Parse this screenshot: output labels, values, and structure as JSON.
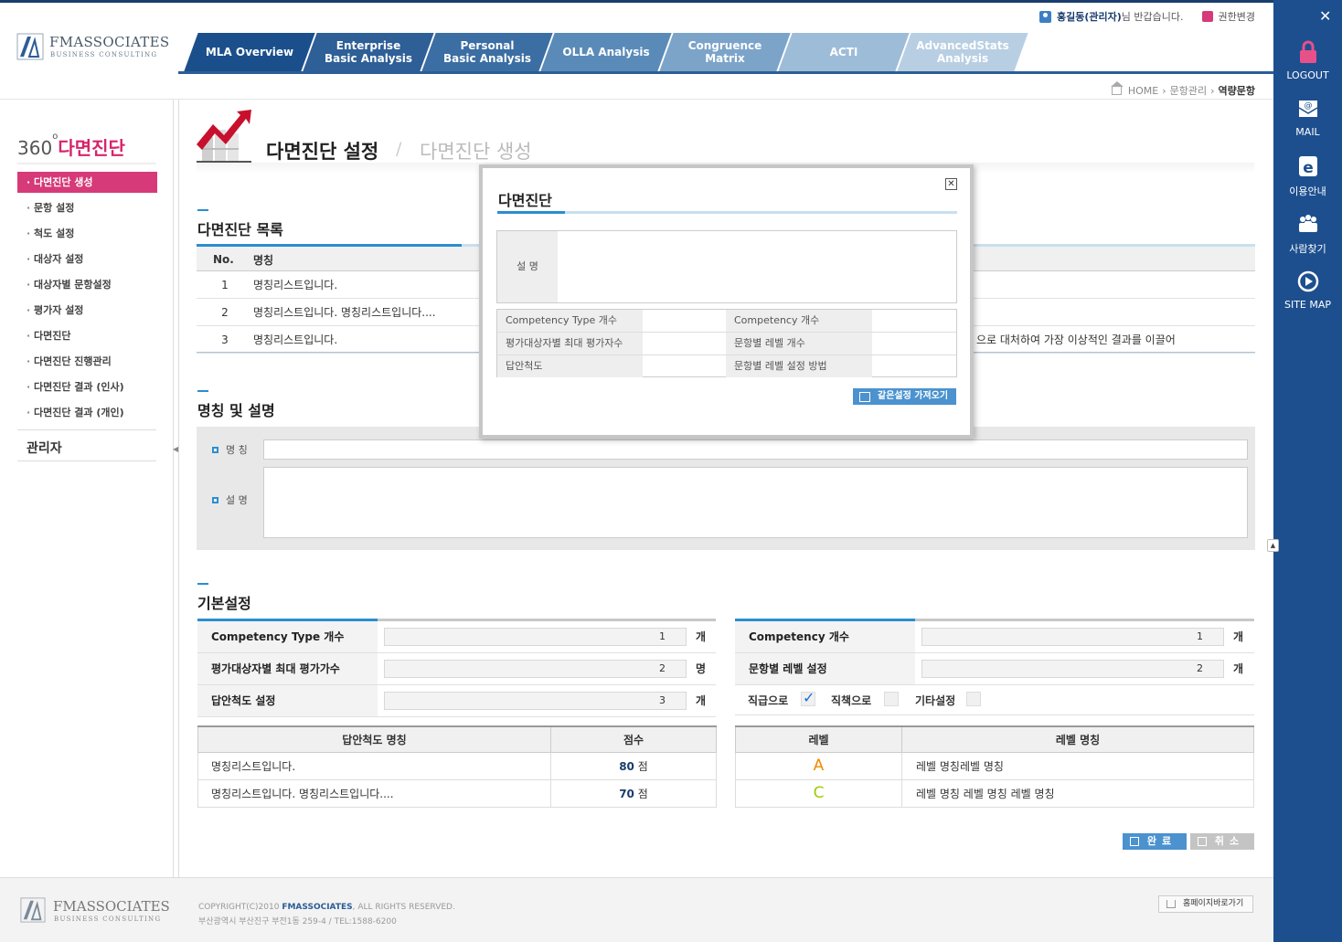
{
  "brand": {
    "name": "FMASSOCIATES",
    "tagline": "BUSINESS CONSULTING"
  },
  "user": {
    "name": "홍길동(관리자)",
    "greeting": "님 반갑습니다.",
    "role_change": "권한변경"
  },
  "nav": {
    "tabs": [
      {
        "label": "MLA Overview",
        "color": "#1a4f8c"
      },
      {
        "label": "Enterprise\nBasic Analysis",
        "color": "#2e5f96"
      },
      {
        "label": "Personal\nBasic Analysis",
        "color": "#3b6ea3"
      },
      {
        "label": "OLLA Analysis",
        "color": "#5a8bb8"
      },
      {
        "label": "Congruence\nMatrix",
        "color": "#7ca4c9"
      },
      {
        "label": "ACTI",
        "color": "#9dbcd8"
      },
      {
        "label": "AdvancedStats\nAnalysis",
        "color": "#b8cfe3"
      }
    ]
  },
  "breadcrumb": {
    "home": "HOME",
    "level1": "문항관리",
    "current": "역량문항"
  },
  "sidebar": {
    "title_num": "360",
    "title_deg": "o",
    "title_text": "다면진단",
    "items": [
      {
        "label": "다면진단 생성",
        "active": true
      },
      {
        "label": "문항 설정"
      },
      {
        "label": "척도 설정"
      },
      {
        "label": "대상자 설정"
      },
      {
        "label": "대상자별 문항설정"
      },
      {
        "label": "평가자 설정"
      },
      {
        "label": "다면진단"
      },
      {
        "label": "다면진단 진행관리"
      },
      {
        "label": "다면진단 결과 (인사)"
      },
      {
        "label": "다면진단 결과 (개인)"
      }
    ],
    "admin": "관리자"
  },
  "page": {
    "title": "다면진단 설정",
    "sub": "다면진단 생성"
  },
  "list": {
    "title": "다면진단 목록",
    "headers": {
      "no": "No.",
      "name": "명칭"
    },
    "rows": [
      {
        "no": "1",
        "name": "명칭리스트입니다.",
        "extra": ""
      },
      {
        "no": "2",
        "name": "명칭리스트입니다. 명칭리스트입니다....",
        "extra": ""
      },
      {
        "no": "3",
        "name": "명칭리스트입니다.",
        "extra": "으로 대처하여 가장 이상적인 결과를 이끌어"
      }
    ]
  },
  "namedesc": {
    "title": "명칭 및 설명",
    "name_label": "명 칭",
    "desc_label": "설 명"
  },
  "basic": {
    "title": "기본설정",
    "left": [
      {
        "label": "Competency Type 개수",
        "value": "1",
        "unit": "개"
      },
      {
        "label": "평가대상자별 최대 평가가수",
        "value": "2",
        "unit": "명"
      },
      {
        "label": "답안척도 설정",
        "value": "3",
        "unit": "개"
      }
    ],
    "right": [
      {
        "label": "Competency 개수",
        "value": "1",
        "unit": "개"
      },
      {
        "label": "문항별 레벨 설정",
        "value": "2",
        "unit": "개"
      }
    ],
    "checks": [
      {
        "label": "직급으로",
        "checked": true
      },
      {
        "label": "직책으로",
        "checked": false
      },
      {
        "label": "기타설정",
        "checked": false
      }
    ],
    "scale_table": {
      "headers": [
        "답안척도 명칭",
        "점수"
      ],
      "rows": [
        {
          "name": "명칭리스트입니다.",
          "score": "80",
          "unit": "점"
        },
        {
          "name": "명칭리스트입니다. 명칭리스트입니다....",
          "score": "70",
          "unit": "점"
        }
      ]
    },
    "level_table": {
      "headers": [
        "레벨",
        "레벨 명칭"
      ],
      "rows": [
        {
          "level": "A",
          "color": "#f08a00",
          "name": "레벨 명칭레벨 명칭"
        },
        {
          "level": "C",
          "color": "#9acd00",
          "name": "레벨 명칭 레벨 명칭 레벨 명칭"
        }
      ]
    },
    "done_label": "완료",
    "cancel_label": "취소"
  },
  "modal": {
    "title": "다면진단",
    "desc_label": "설 명",
    "rows": [
      [
        "Competency Type 개수",
        "Competency 개수"
      ],
      [
        "평가대상자별 최대 평가자수",
        "문항별 레벨 개수"
      ],
      [
        "답안척도",
        "문항별 레벨 설정 방법"
      ]
    ],
    "import_button": "같은설정 가져오기"
  },
  "rail": {
    "items": [
      {
        "label": "LOGOUT",
        "icon": "lock-icon"
      },
      {
        "label": "MAIL",
        "icon": "mail-icon"
      },
      {
        "label": "이용안내",
        "icon": "guide-icon"
      },
      {
        "label": "사람찾기",
        "icon": "people-icon"
      },
      {
        "label": "SITE MAP",
        "icon": "sitemap-icon"
      }
    ]
  },
  "footer": {
    "copyright_pre": "COPYRIGHT(C)2010 ",
    "copyright_brand": "FMASSOCIATES",
    "copyright_post": ", ALL RIGHTS RESERVED.",
    "address": "부산광역시 부산진구 부전1동 259-4 /  TEL:1588-6200",
    "homepage_button": "홈페이지바로가기"
  }
}
